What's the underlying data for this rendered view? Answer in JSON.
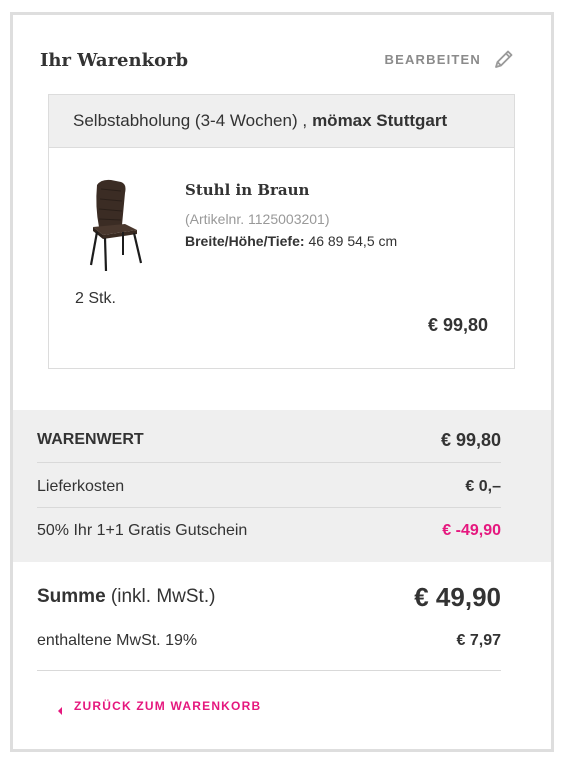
{
  "header": {
    "title": "Ihr Warenkorb",
    "edit_label": "BEARBEITEN",
    "edit_icon": "pencil-icon"
  },
  "store": {
    "delivery": "Selbstabholung (3-4 Wochen) ,",
    "name": "mömax Stuttgart"
  },
  "item": {
    "name": "Stuhl in Braun",
    "article_no": "(Artikelnr. 1125003201)",
    "dims_label": "Breite/Höhe/Tiefe:",
    "dims_value": "46 89 54,5 cm",
    "quantity": "2 Stk.",
    "price": "€ 99,80",
    "image_icon": "chair-image"
  },
  "summary": {
    "warenwert_label": "WARENWERT",
    "warenwert_value": "€ 99,80",
    "liefer_label": "Lieferkosten",
    "liefer_value": "€ 0,–",
    "gutschein_label": "50% Ihr 1+1 Gratis Gutschein",
    "gutschein_value": "€ -49,90",
    "summe_label": "Summe",
    "summe_suffix": "(inkl. MwSt.)",
    "summe_value": "€ 49,90",
    "mwst_label": "enthaltene MwSt. 19%",
    "mwst_value": "€ 7,97"
  },
  "back": {
    "label": "ZURÜCK ZUM WARENKORB",
    "icon": "caret-left-icon"
  },
  "colors": {
    "accent": "#e5177e",
    "grey_bg": "#efefef",
    "border": "#dedede"
  }
}
